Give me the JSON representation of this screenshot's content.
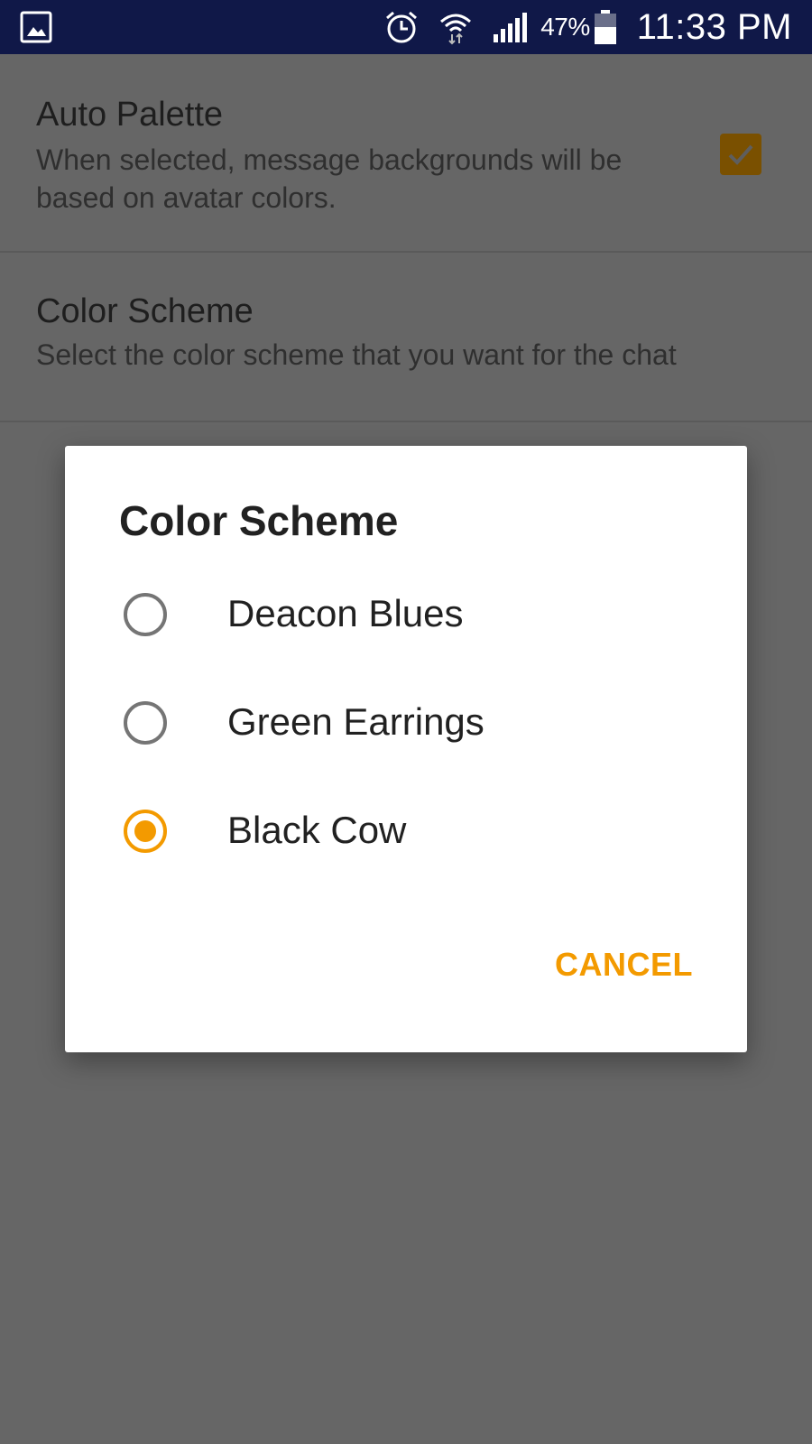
{
  "status_bar": {
    "battery_percent": "47%",
    "time": "11:33 PM",
    "icons": [
      "gallery-icon",
      "alarm-icon",
      "wifi-icon",
      "signal-icon",
      "battery-icon"
    ]
  },
  "settings": {
    "auto_palette": {
      "title": "Auto Palette",
      "summary": "When selected, message backgrounds will be based on avatar colors.",
      "checked": true
    },
    "color_scheme": {
      "title": "Color Scheme",
      "summary": "Select the color scheme that you want for the chat"
    }
  },
  "dialog": {
    "title": "Color Scheme",
    "options": [
      {
        "label": "Deacon Blues",
        "selected": false
      },
      {
        "label": "Green Earrings",
        "selected": false
      },
      {
        "label": "Black Cow",
        "selected": true
      }
    ],
    "cancel_label": "CANCEL"
  },
  "colors": {
    "status_bar_bg": "#101848",
    "accent": "#F39A00",
    "scrim_bg": "#666666",
    "dialog_bg": "#FFFFFF"
  }
}
